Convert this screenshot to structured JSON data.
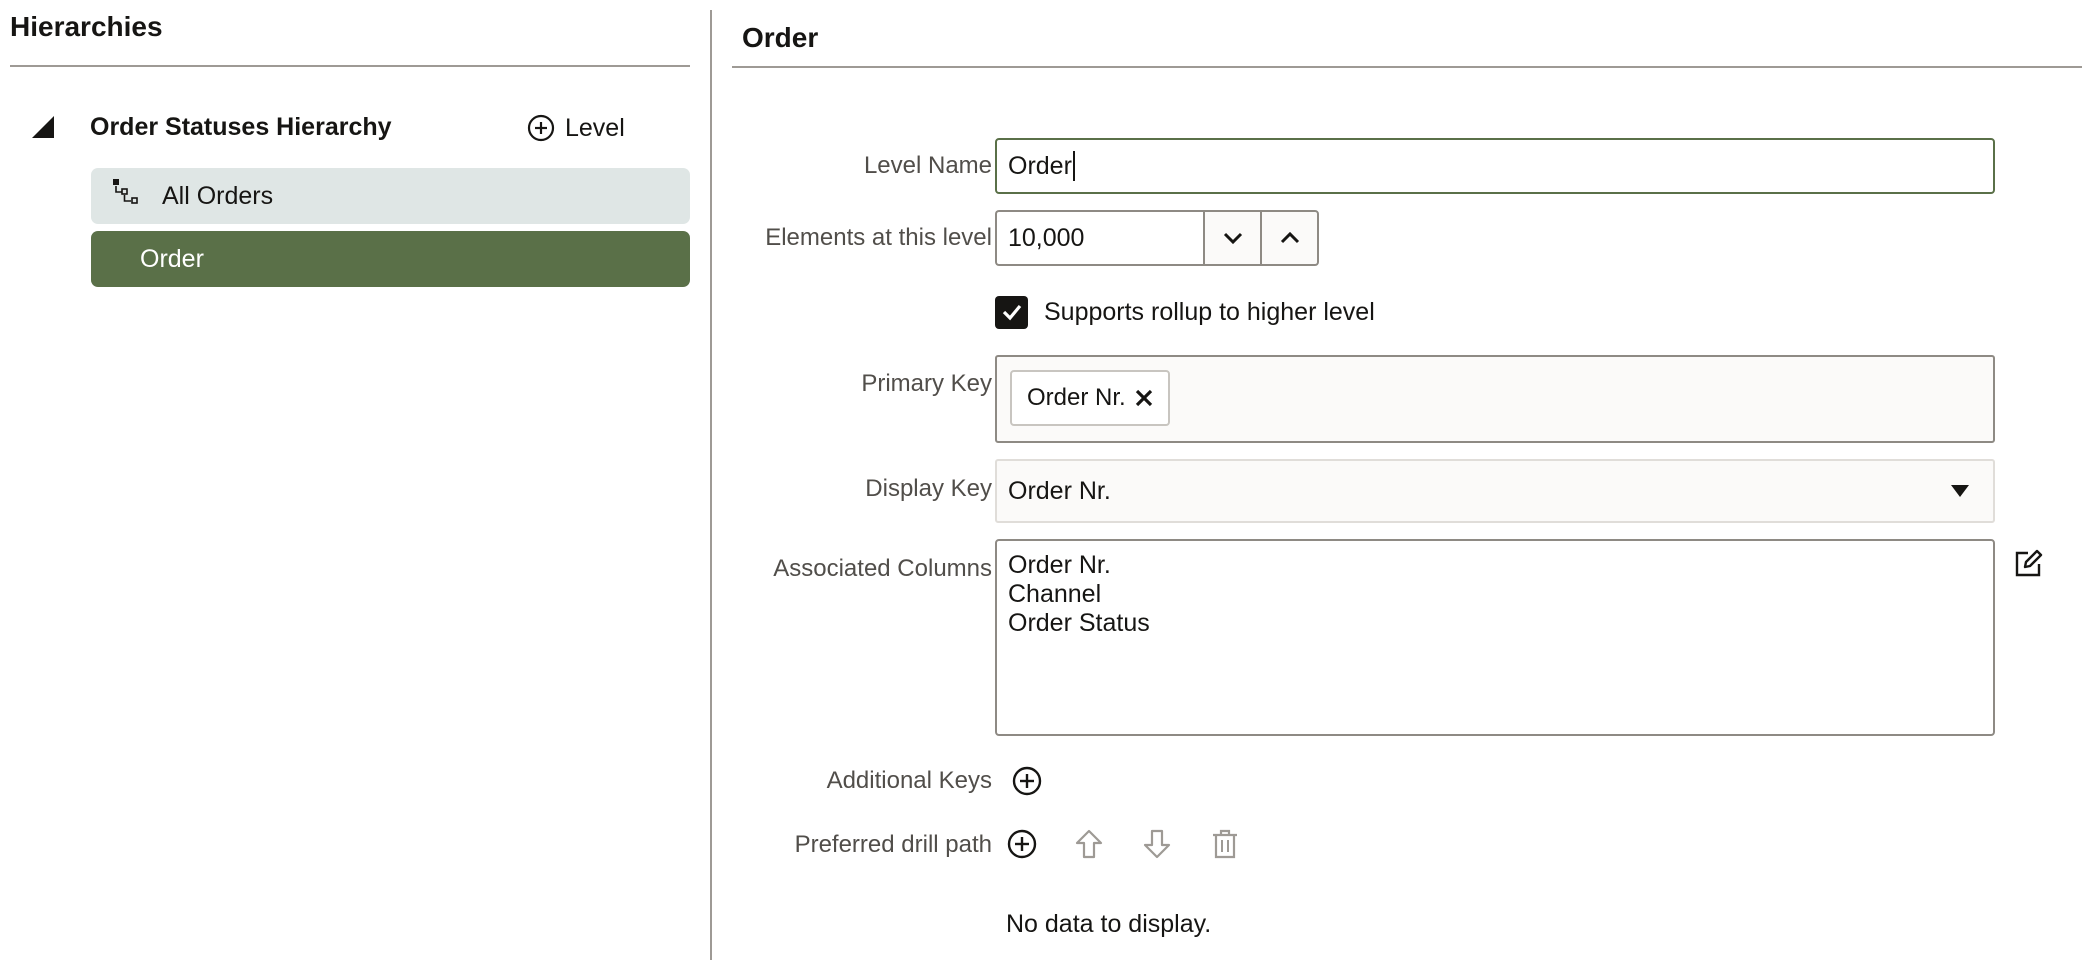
{
  "left_panel": {
    "title": "Hierarchies",
    "hierarchy": {
      "name": "Order Statuses Hierarchy",
      "add_level_label": "Level",
      "toggle_icon": "collapse-triangle-icon",
      "add_icon": "plus-circle-icon"
    },
    "levels": [
      {
        "label": "All Orders",
        "icon": "hierarchy-node-icon",
        "selected": false
      },
      {
        "label": "Order",
        "selected": true
      }
    ]
  },
  "form": {
    "title": "Order",
    "level_name": {
      "label": "Level Name",
      "value": "Order"
    },
    "elements": {
      "label": "Elements at this level",
      "value": "10,000",
      "decrement_icon": "chevron-down-icon",
      "increment_icon": "chevron-up-icon"
    },
    "supports_rollup": {
      "label": "Supports rollup to higher level",
      "checked": true
    },
    "primary_key": {
      "label": "Primary Key",
      "chips": [
        {
          "label": "Order Nr.",
          "remove_icon": "close-icon"
        }
      ]
    },
    "display_key": {
      "label": "Display Key",
      "value": "Order Nr.",
      "arrow_icon": "caret-down-icon"
    },
    "associated_columns": {
      "label": "Associated Columns",
      "values": [
        "Order Nr.",
        "Channel",
        "Order Status"
      ],
      "edit_icon": "edit-icon"
    },
    "additional_keys": {
      "label": "Additional Keys",
      "add_icon": "plus-circle-icon"
    },
    "preferred_drill_path": {
      "label": "Preferred drill path",
      "icons": [
        "plus-circle-icon",
        "arrow-up-icon",
        "arrow-down-icon",
        "trash-icon"
      ],
      "empty_message": "No data to display."
    }
  },
  "colors": {
    "accent": "#5a7048",
    "selected_row_bg": "#5a7048",
    "row_bg": "#dfe6e5",
    "text": "#161513",
    "label_text": "#514e4a",
    "border": "#8e8a84",
    "disabled_icon": "#9e9a95"
  }
}
